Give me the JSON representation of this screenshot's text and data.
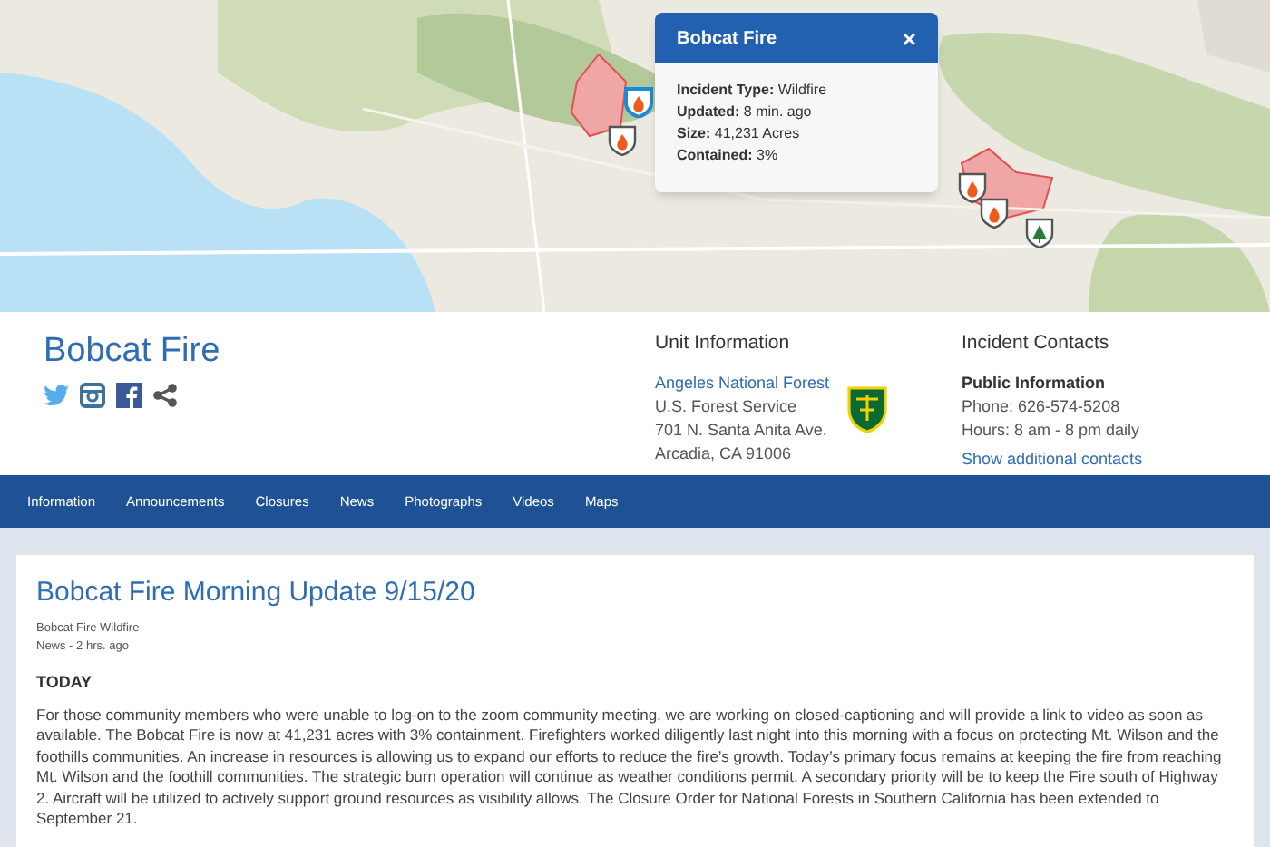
{
  "map": {
    "markers": [
      {
        "kind": "fire",
        "selected": true
      },
      {
        "kind": "fire",
        "selected": false
      },
      {
        "kind": "fire",
        "selected": false
      },
      {
        "kind": "fire",
        "selected": false
      },
      {
        "kind": "forest",
        "selected": false
      }
    ]
  },
  "popup": {
    "title": "Bobcat Fire",
    "close": "×",
    "fields": [
      {
        "label": "Incident Type:",
        "value": "Wildfire"
      },
      {
        "label": "Updated:",
        "value": "8 min. ago"
      },
      {
        "label": "Size:",
        "value": "41,231 Acres"
      },
      {
        "label": "Contained:",
        "value": "3%"
      }
    ]
  },
  "incident": {
    "title": "Bobcat Fire",
    "social": [
      {
        "kind": "twitter"
      },
      {
        "kind": "instagram"
      },
      {
        "kind": "facebook"
      },
      {
        "kind": "share"
      }
    ]
  },
  "unit_information": {
    "heading": "Unit Information",
    "link": "Angeles National Forest",
    "lines": [
      "U.S. Forest Service",
      "701 N. Santa Anita Ave.",
      "Arcadia, CA 91006"
    ]
  },
  "incident_contacts": {
    "heading": "Incident Contacts",
    "name": "Public Information",
    "lines": [
      "Phone: 626-574-5208",
      "Hours: 8 am - 8 pm daily"
    ],
    "link": "Show additional contacts"
  },
  "nav": [
    "Information",
    "Announcements",
    "Closures",
    "News",
    "Photographs",
    "Videos",
    "Maps"
  ],
  "article": {
    "title": "Bobcat Fire Morning Update 9/15/20",
    "author": "Bobcat Fire Wildfire",
    "meta": "News - 2 hrs. ago",
    "section": "TODAY",
    "body": "For those community members who were unable to log-on to the zoom community meeting, we are working on closed-captioning and will provide a link to video as soon as available. The Bobcat Fire is now at 41,231 acres with 3% containment. Firefighters worked diligently last night into this morning with a focus on protecting Mt. Wilson and the foothills communities. An increase in resources is allowing us to expand our efforts to reduce the fire’s growth. Today’s primary focus remains at keeping the fire from reaching Mt. Wilson and the foothill communities. The strategic burn operation will continue as weather conditions permit. A secondary priority will be to keep the Fire south of Highway 2. Aircraft will be utilized to actively support ground resources as visibility allows. The Closure Order for National Forests in Southern California has been extended to September 21."
  }
}
